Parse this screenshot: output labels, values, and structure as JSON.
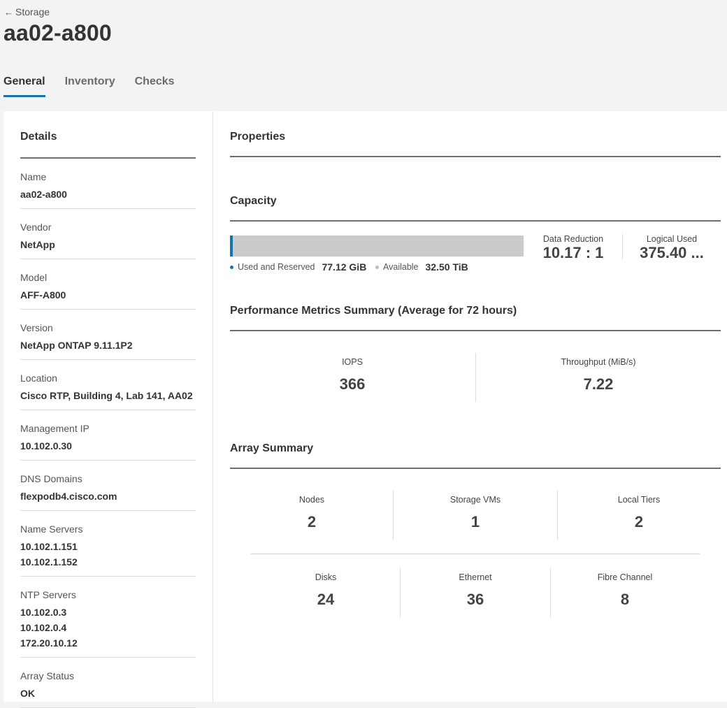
{
  "header": {
    "back_label": "Storage",
    "title": "aa02-a800"
  },
  "tabs": [
    {
      "label": "General",
      "active": true
    },
    {
      "label": "Inventory",
      "active": false
    },
    {
      "label": "Checks",
      "active": false
    }
  ],
  "details": {
    "title": "Details",
    "name": {
      "label": "Name",
      "value": "aa02-a800"
    },
    "vendor": {
      "label": "Vendor",
      "value": "NetApp"
    },
    "model": {
      "label": "Model",
      "value": "AFF-A800"
    },
    "version": {
      "label": "Version",
      "value": "NetApp ONTAP 9.11.1P2"
    },
    "location": {
      "label": "Location",
      "value": "Cisco RTP, Building 4, Lab 141, AA02"
    },
    "management_ip": {
      "label": "Management IP",
      "value": "10.102.0.30"
    },
    "dns_domains": {
      "label": "DNS Domains",
      "value": "flexpodb4.cisco.com"
    },
    "name_servers": {
      "label": "Name Servers",
      "values": [
        "10.102.1.151",
        "10.102.1.152"
      ]
    },
    "ntp_servers": {
      "label": "NTP Servers",
      "values": [
        "10.102.0.3",
        "10.102.0.4",
        "172.20.10.12"
      ]
    },
    "array_status": {
      "label": "Array Status",
      "value": "OK"
    }
  },
  "properties": {
    "title": "Properties"
  },
  "capacity": {
    "title": "Capacity",
    "used_fraction": 0.0023,
    "used_label": "Used and Reserved",
    "used_value": "77.12 GiB",
    "available_label": "Available",
    "available_value": "32.50 TiB",
    "data_reduction_label": "Data Reduction",
    "data_reduction_value": "10.17 : 1",
    "logical_used_label": "Logical Used",
    "logical_used_value": "375.40 ...",
    "colors": {
      "used": "#1a73a8",
      "available": "#cbcbcb"
    }
  },
  "performance": {
    "title": "Performance Metrics Summary (Average for 72 hours)",
    "iops_label": "IOPS",
    "iops_value": "366",
    "throughput_label": "Throughput (MiB/s)",
    "throughput_value": "7.22"
  },
  "array_summary": {
    "title": "Array Summary",
    "nodes": {
      "label": "Nodes",
      "value": "2"
    },
    "storage_vms": {
      "label": "Storage VMs",
      "value": "1"
    },
    "local_tiers": {
      "label": "Local Tiers",
      "value": "2"
    },
    "disks": {
      "label": "Disks",
      "value": "24"
    },
    "ethernet": {
      "label": "Ethernet",
      "value": "36"
    },
    "fibre_channel": {
      "label": "Fibre Channel",
      "value": "8"
    }
  }
}
